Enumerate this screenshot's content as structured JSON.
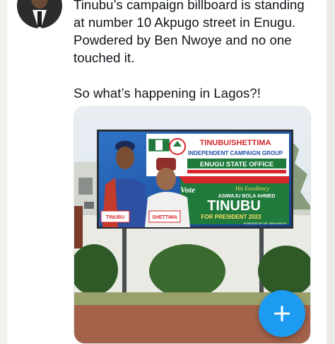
{
  "tweet": {
    "paragraph_1": "Tinubu’s campaign billboard is standing\nat number 10 Akpugo street in Enugu.\nPowdered by Ben Nwoye and no one\ntouched it.",
    "paragraph_2": "So what’s happening in Lagos?!"
  },
  "billboard": {
    "header_line_1": "TINUBU/SHETTIMA",
    "header_line_2": "INDEPENDENT CAMPAIGN GROUP",
    "header_line_3": "ENUGU STATE OFFICE",
    "vote": "Vote",
    "his_excellency": "His Excellency",
    "full_name": "ASIWAJU BOLA AHMED",
    "surname": "TINUBU",
    "office": "FOR PRESIDENT 2023",
    "powered_by": "POWERED BY DR. BEN NWOYE",
    "badge_left": "TINUBU",
    "badge_mid": "SHETTIMA"
  },
  "fab": {
    "icon": "plus-icon"
  },
  "colors": {
    "accent": "#1d9bf0",
    "billboard_green": "#1f7a3b",
    "billboard_red": "#d7262b",
    "billboard_blue": "#1f4fa8"
  }
}
